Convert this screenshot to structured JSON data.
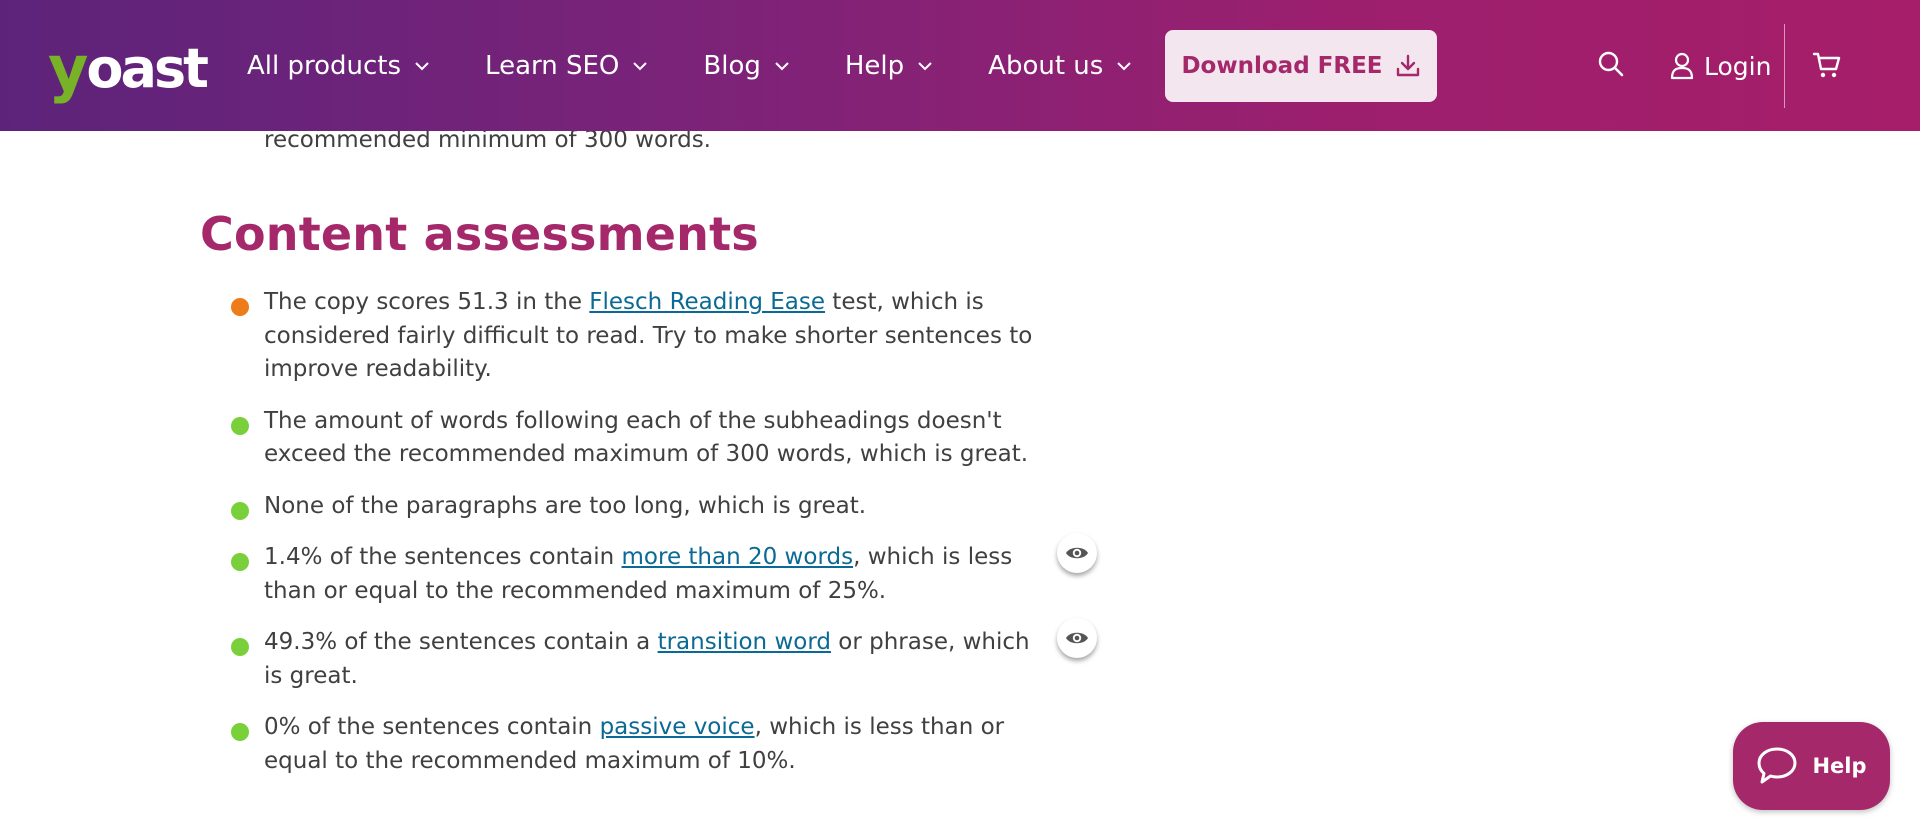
{
  "header": {
    "logo": {
      "y": "y",
      "rest": "oast",
      "y_color": "#77b227"
    },
    "nav": [
      {
        "label": "All products"
      },
      {
        "label": "Learn SEO"
      },
      {
        "label": "Blog"
      },
      {
        "label": "Help"
      },
      {
        "label": "About us"
      }
    ],
    "download_label": "Download FREE",
    "login_label": "Login",
    "colors": {
      "gradient_start": "#5d237a",
      "gradient_end": "#a61e69",
      "download_text": "#a4286a"
    }
  },
  "content": {
    "prev_text": "recommended minimum of 300 words.",
    "section_title": "Content assessments",
    "assessments": [
      {
        "status": "orange",
        "color": "#ee7c1b",
        "pre": "The copy scores 51.3 in the ",
        "link": "Flesch Reading Ease",
        "post": " test, which is considered fairly difficult to read. Try to make shorter sentences to improve readability.",
        "has_eye": false
      },
      {
        "status": "green",
        "color": "#7ad03a",
        "pre": "The amount of words following each of the subheadings doesn't exceed the recommended maximum of 300 words, which is great.",
        "link": "",
        "post": "",
        "has_eye": false
      },
      {
        "status": "green",
        "color": "#7ad03a",
        "pre": "None of the paragraphs are too long, which is great.",
        "link": "",
        "post": "",
        "has_eye": false
      },
      {
        "status": "green",
        "color": "#7ad03a",
        "pre": "1.4% of the sentences contain ",
        "link": "more than 20 words",
        "post": ", which is less than or equal to the recommended maximum of 25%.",
        "has_eye": true
      },
      {
        "status": "green",
        "color": "#7ad03a",
        "pre": "49.3% of the sentences contain a ",
        "link": "transition word",
        "post": " or phrase, which is great.",
        "has_eye": true
      },
      {
        "status": "green",
        "color": "#7ad03a",
        "pre": "0% of the sentences contain ",
        "link": "passive voice",
        "post": ", which is less than or equal to the recommended maximum of 10%.",
        "has_eye": false
      }
    ]
  },
  "help_widget": {
    "label": "Help",
    "color": "#a4286a"
  },
  "icons": [
    "chevron-down-icon",
    "download-icon",
    "search-icon",
    "user-icon",
    "cart-icon",
    "eye-icon",
    "chat-bubble-icon"
  ]
}
